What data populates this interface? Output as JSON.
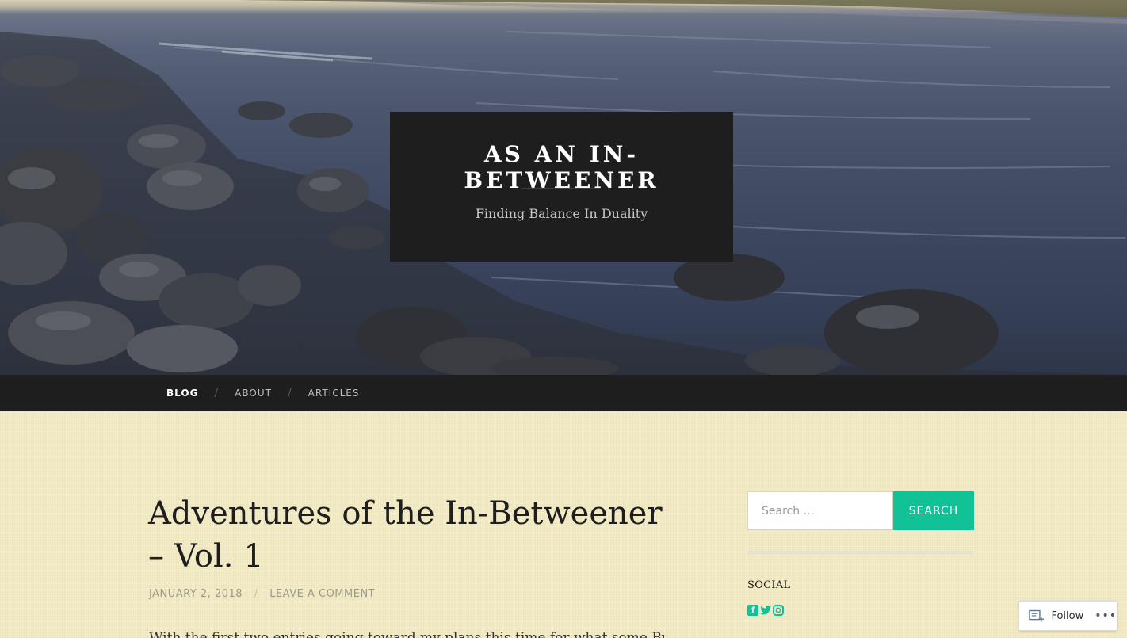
{
  "site": {
    "title": "As an In-Betweener",
    "tagline": "Finding Balance In Duality"
  },
  "nav": {
    "items": [
      {
        "label": "Blog",
        "current": true
      },
      {
        "label": "About",
        "current": false
      },
      {
        "label": "Articles",
        "current": false
      }
    ],
    "separator": "/"
  },
  "post": {
    "title": "Adventures of the In-Betweener – Vol. 1",
    "date": "January 2, 2018",
    "comment_link": "Leave a comment",
    "excerpt": "With the first two entries going toward my plans this time for what some By"
  },
  "sidebar": {
    "search": {
      "placeholder": "Search …",
      "button_label": "Search"
    },
    "social_title": "Social",
    "social_icons": [
      "facebook-icon",
      "twitter-icon",
      "instagram-icon"
    ]
  },
  "follow": {
    "label": "Follow",
    "more": "•••"
  },
  "colors": {
    "accent": "#11c296",
    "dark": "#1e1e1e",
    "background": "#f4ecc6"
  }
}
